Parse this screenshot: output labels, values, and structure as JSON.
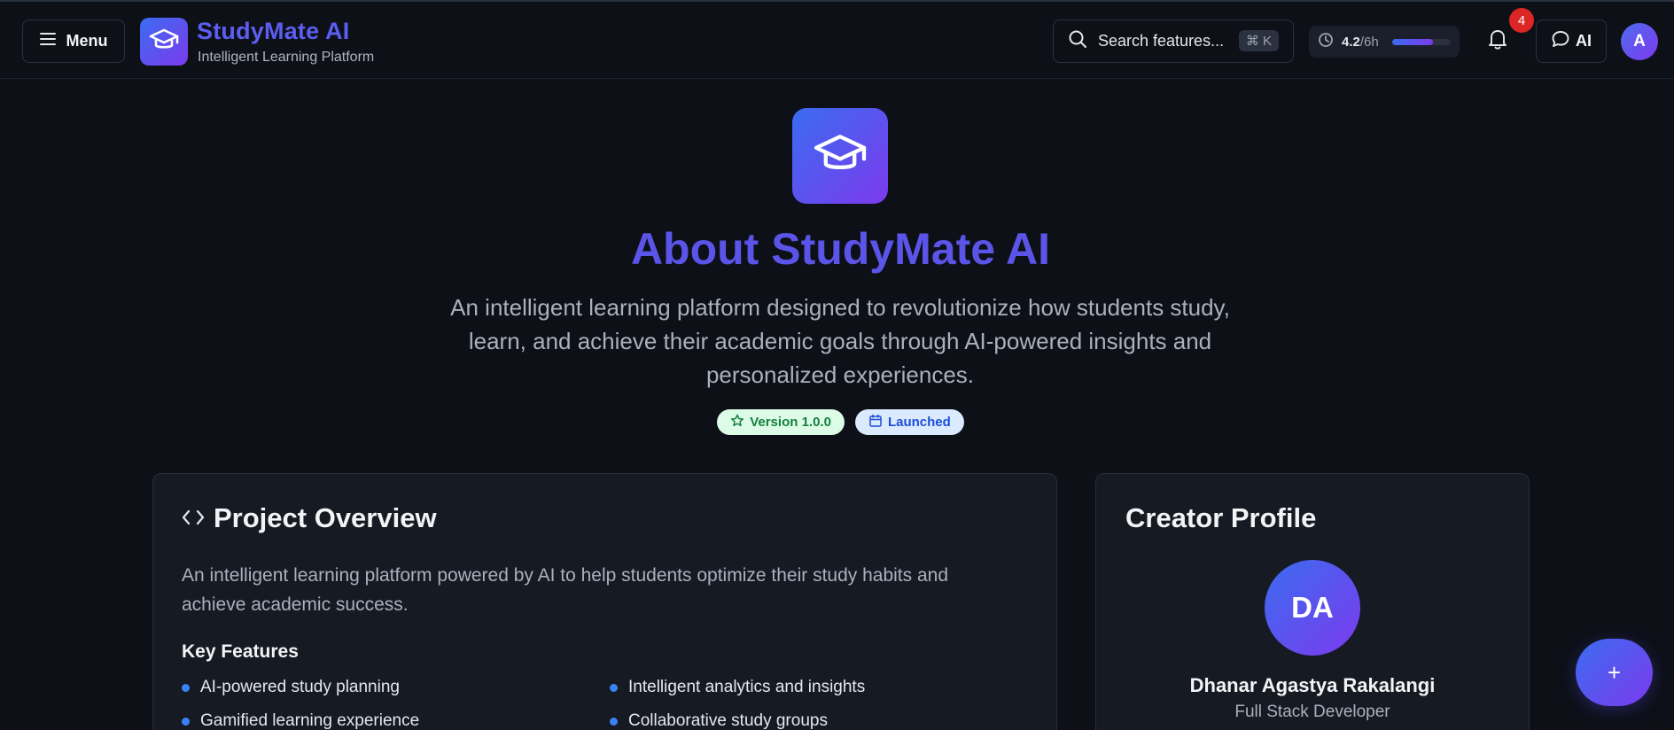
{
  "header": {
    "menu_label": "Menu",
    "brand_name": "StudyMate AI",
    "brand_tagline": "Intelligent Learning Platform",
    "search_placeholder": "Search features...",
    "search_shortcut": "⌘ K",
    "study_value": "4.2",
    "study_unit": "/6h",
    "study_progress": 0.7,
    "notification_count": "4",
    "ai_label": "AI",
    "user_initial": "A"
  },
  "hero": {
    "title": "About StudyMate AI",
    "description": "An intelligent learning platform designed to revolutionize how students study, learn, and achieve their academic goals through AI-powered insights and personalized experiences.",
    "badges": {
      "version": "Version 1.0.0",
      "status": "Launched"
    }
  },
  "overview": {
    "title": "Project Overview",
    "description": "An intelligent learning platform powered by AI to help students optimize their study habits and achieve academic success.",
    "key_features_title": "Key Features",
    "features": [
      "AI-powered study planning",
      "Intelligent analytics and insights",
      "Gamified learning experience",
      "Collaborative study groups"
    ]
  },
  "creator": {
    "title": "Creator Profile",
    "initials": "DA",
    "name": "Dhanar Agastya Rakalangi",
    "role": "Full Stack Developer"
  },
  "fab_label": "+",
  "colors": {
    "accent_start": "#3b6cf0",
    "accent_end": "#7c3aed",
    "title_purple": "#5b54e8",
    "background": "#0d1017",
    "card": "#161a23",
    "badge_red": "#dc2626",
    "feature_dot": "#3b82f6"
  }
}
